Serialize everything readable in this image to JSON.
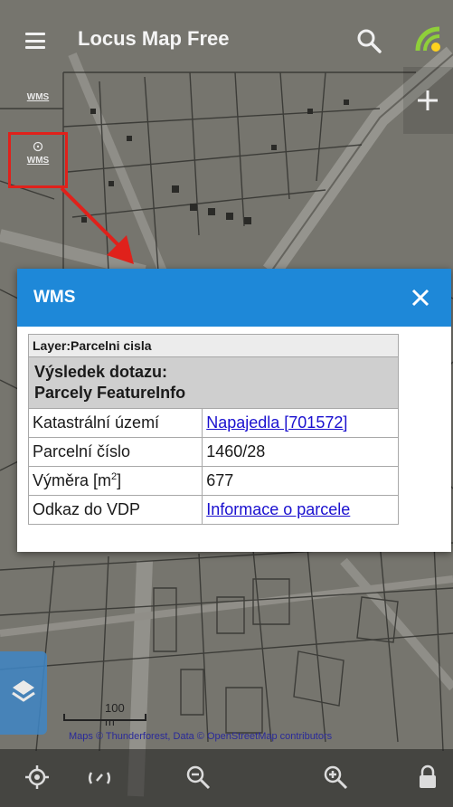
{
  "app": {
    "title": "Locus Map Free"
  },
  "left_buttons": [
    {
      "label": "WMS"
    },
    {
      "label": "WMS"
    }
  ],
  "dialog": {
    "title": "WMS",
    "layer_label": "Layer:Parcelni cisla",
    "result_heading_line1": "Výsledek dotazu:",
    "result_heading_line2": "Parcely FeatureInfo",
    "rows": [
      {
        "label": "Katastrální území",
        "value": "Napajedla [701572]",
        "is_link": true
      },
      {
        "label": "Parcelní číslo",
        "value": "1460/28",
        "is_link": false
      },
      {
        "label_base": "Výměra [m",
        "label_sup": "2",
        "label_end": "]",
        "value": "677",
        "is_link": false
      },
      {
        "label": "Odkaz do VDP",
        "value": "Informace o parcele",
        "is_link": true
      }
    ]
  },
  "map": {
    "scale_label": "100 m",
    "attribution": "Maps © Thunderforest, Data © OpenStreetMap contributors"
  },
  "icons": {
    "menu": "menu-icon",
    "search": "search-icon",
    "gps": "gps-icon",
    "close": "close-icon",
    "layers": "layers-icon",
    "plus": "plus-icon",
    "location": "location-icon",
    "rotate": "rotate-icon",
    "zoom_out": "zoom-out-icon",
    "zoom_in": "zoom-in-icon",
    "lock": "lock-icon"
  },
  "colors": {
    "header": "#1e88d8",
    "highlight": "#e0211b",
    "link": "#1a10cf",
    "arrow": "#e0211b"
  }
}
